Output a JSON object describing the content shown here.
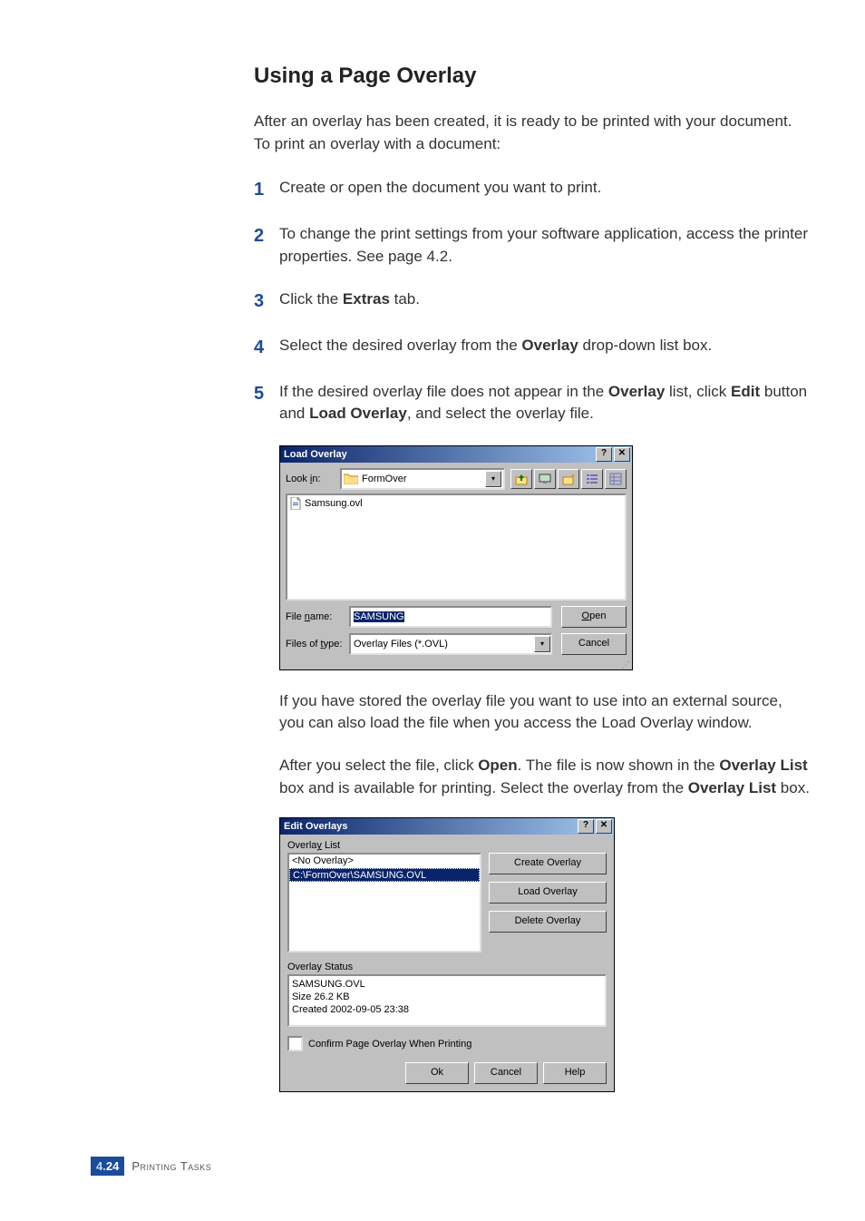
{
  "heading": "Using a Page Overlay",
  "intro": "After an overlay has been created, it is ready to be printed with your document. To print an overlay with a document:",
  "steps": {
    "s1": "Create or open the document you want to print.",
    "s2a": "To change the print settings from your software application, access the printer properties. See ",
    "s2b": "page 4.2",
    "s2c": ".",
    "s3a": "Click the ",
    "s3b": "Extras",
    "s3c": " tab.",
    "s4a": "Select the desired overlay from the ",
    "s4b": "Overlay",
    "s4c": " drop-down list box.",
    "s5a": "If the desired overlay file does not appear in the ",
    "s5b": "Overlay",
    "s5c": " list, click ",
    "s5d": "Edit",
    "s5e": " button and ",
    "s5f": "Load Overlay",
    "s5g": ", and select the overlay file."
  },
  "dlg1": {
    "title": "Load Overlay",
    "help": "?",
    "close": "✕",
    "lookin_l": "Look ",
    "lookin_u": "i",
    "lookin_r": "n:",
    "folder": "FormOver",
    "file": "Samsung.ovl",
    "filename_l": "File ",
    "filename_u": "n",
    "filename_r": "ame:",
    "filename_val": "SAMSUNG",
    "filetype_l": "Files of ",
    "filetype_u": "t",
    "filetype_r": "ype:",
    "filetype_val": "Overlay Files (*.OVL)",
    "open_u": "O",
    "open_r": "pen",
    "cancel": "Cancel"
  },
  "mid1": "If you have stored the overlay file you want to use into an external source, you can also load the file when you access the Load Overlay window.",
  "mid2a": "After you select the file, click ",
  "mid2b": "Open",
  "mid2c": ". The file is now shown in the ",
  "mid2d": "Overlay List",
  "mid2e": " box and is available for printing. Select the overlay from the ",
  "mid2f": "Overlay List",
  "mid2g": " box.",
  "dlg2": {
    "title": "Edit Overlays",
    "help": "?",
    "close": "✕",
    "listlabel_l": "Overla",
    "listlabel_u": "y",
    "listlabel_r": " List",
    "item1": "<No Overlay>",
    "item2": "C:\\FormOver\\SAMSUNG.OVL",
    "create": "Create Overlay",
    "load": "Load Overlay",
    "delete": "Delete Overlay",
    "status_label": "Overlay Status",
    "status_line1": "SAMSUNG.OVL",
    "status_line2": "Size 26.2 KB",
    "status_line3": "Created 2002-09-05 23:38",
    "confirm": "Confirm Page Overlay When Printing",
    "ok": "Ok",
    "cancel": "Cancel",
    "helpbtn": "Help"
  },
  "footer": {
    "chapter": "4.",
    "page": "24",
    "section": "Printing Tasks"
  },
  "chart_data": null
}
